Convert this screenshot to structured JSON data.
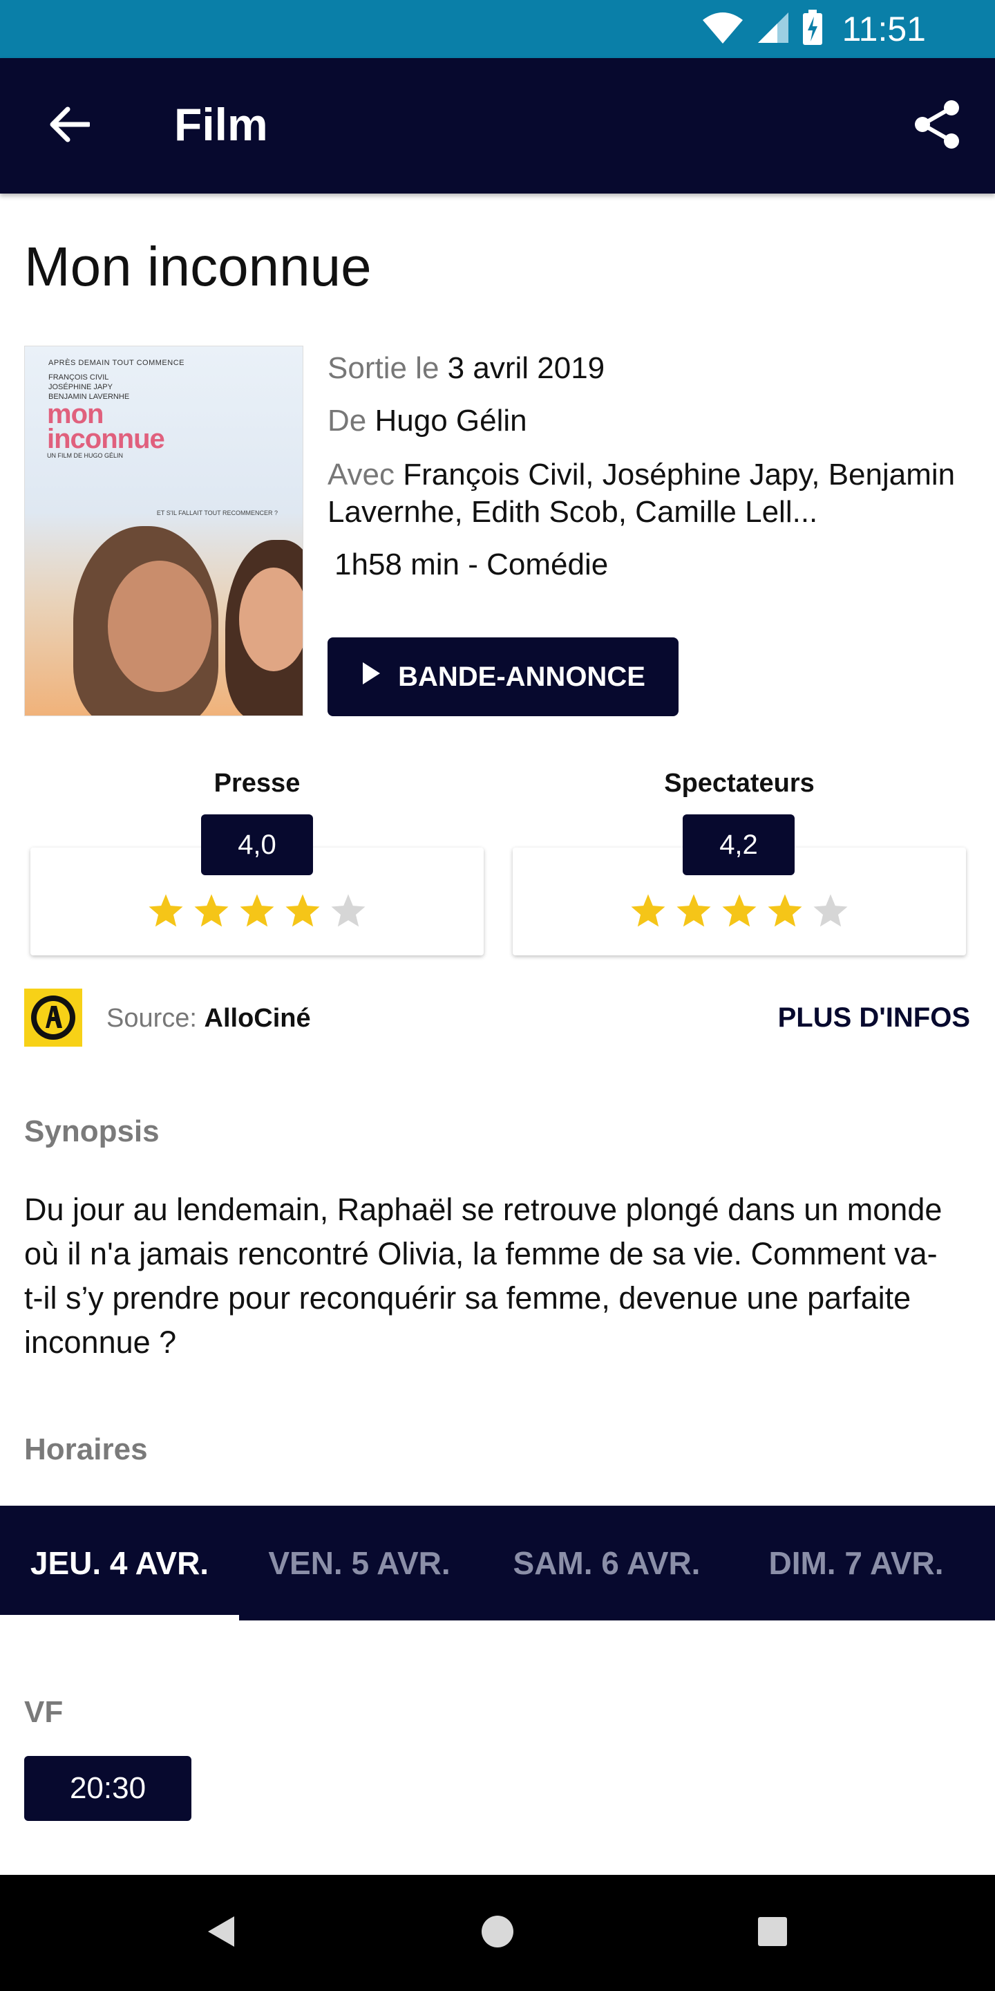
{
  "status": {
    "time": "11:51"
  },
  "appbar": {
    "title": "Film",
    "back_icon": "arrow-left-icon",
    "share_icon": "share-icon"
  },
  "film": {
    "title": "Mon inconnue",
    "poster": {
      "top_line": "APRÈS DEMAIN TOUT COMMENCE",
      "cast_lines": [
        "FRANÇOIS CIVIL",
        "JOSÉPHINE JAPY",
        "BENJAMIN LAVERNHE"
      ],
      "logo_line1": "mon",
      "logo_line2": "inconnue",
      "director_line": "UN FILM DE HUGO GÉLIN",
      "tagline": "ET S'IL FALLAIT TOUT RECOMMENCER ?"
    },
    "release_label": "Sortie le",
    "release_date": "3 avril 2019",
    "director_label": "De",
    "director": "Hugo Gélin",
    "cast_label": "Avec",
    "cast": "François Civil, Joséphine Japy, Benjamin Lavernhe, Edith Scob, Camille Lell...",
    "duration_genre": "1h58 min - Comédie",
    "trailer_label": "BANDE-ANNONCE"
  },
  "ratings": [
    {
      "label": "Presse",
      "score": "4,0",
      "stars": 4
    },
    {
      "label": "Spectateurs",
      "score": "4,2",
      "stars": 4
    }
  ],
  "source": {
    "prefix": "Source:",
    "name": "AlloCiné",
    "more_label": "PLUS D'INFOS"
  },
  "synopsis": {
    "heading": "Synopsis",
    "text": "Du jour au lendemain, Raphaël se retrouve plongé dans un monde où il n'a jamais rencontré Olivia, la femme de sa vie. Comment va-t-il s’y prendre pour reconquérir sa femme, devenue une parfaite inconnue ?"
  },
  "schedule": {
    "heading": "Horaires",
    "tabs": [
      "JEU. 4 AVR.",
      "VEN. 5 AVR.",
      "SAM. 6 AVR.",
      "DIM. 7 AVR."
    ],
    "active_tab": 0,
    "version": "VF",
    "times": [
      "20:30"
    ]
  },
  "colors": {
    "navy": "#07092e",
    "status": "#0a7fa8",
    "star": "#f5c518",
    "star_empty": "#d6d6d6",
    "allocine": "#f7d117"
  }
}
